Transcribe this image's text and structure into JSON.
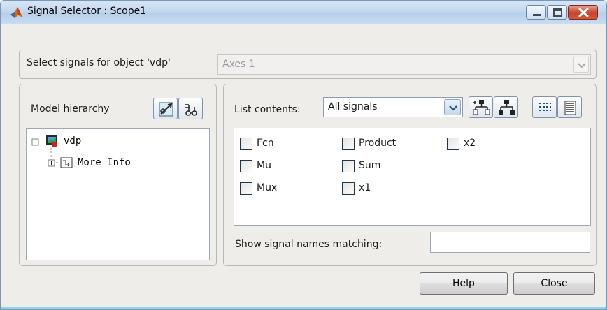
{
  "window": {
    "title": "Signal Selector : Scope1",
    "icon": "matlab-icon",
    "controls": [
      "minimize-icon",
      "maximize-icon",
      "close-icon"
    ]
  },
  "object_selector": {
    "label": "Select signals for object 'vdp'",
    "value": "Axes 1",
    "enabled": false
  },
  "model_hierarchy": {
    "label": "Model hierarchy",
    "tools": [
      "find-icon",
      "signal-filter-icon"
    ],
    "tree": {
      "root": {
        "label": "vdp",
        "icon": "simulink-model-icon",
        "expanded": true
      },
      "children": [
        {
          "label": "More Info",
          "icon": "subsystem-icon",
          "expanded": false
        }
      ]
    }
  },
  "list_contents": {
    "label": "List contents:",
    "value": "All signals",
    "tools": [
      "expand-hierarchy-icon",
      "collapse-hierarchy-icon",
      "list-view-icon",
      "details-view-icon"
    ]
  },
  "signals": [
    {
      "label": "Fcn",
      "checked": false
    },
    {
      "label": "Mu",
      "checked": false
    },
    {
      "label": "Mux",
      "checked": false
    },
    {
      "label": "Product",
      "checked": false
    },
    {
      "label": "Sum",
      "checked": false
    },
    {
      "label": "x1",
      "checked": false
    },
    {
      "label": "x2",
      "checked": false
    }
  ],
  "filter": {
    "label": "Show signal names matching:",
    "value": ""
  },
  "buttons": {
    "help": "Help",
    "close": "Close"
  },
  "colors": {
    "titlebar": "#c3d8ef",
    "window_bg": "#eeede9",
    "close_button": "#c7432b"
  }
}
